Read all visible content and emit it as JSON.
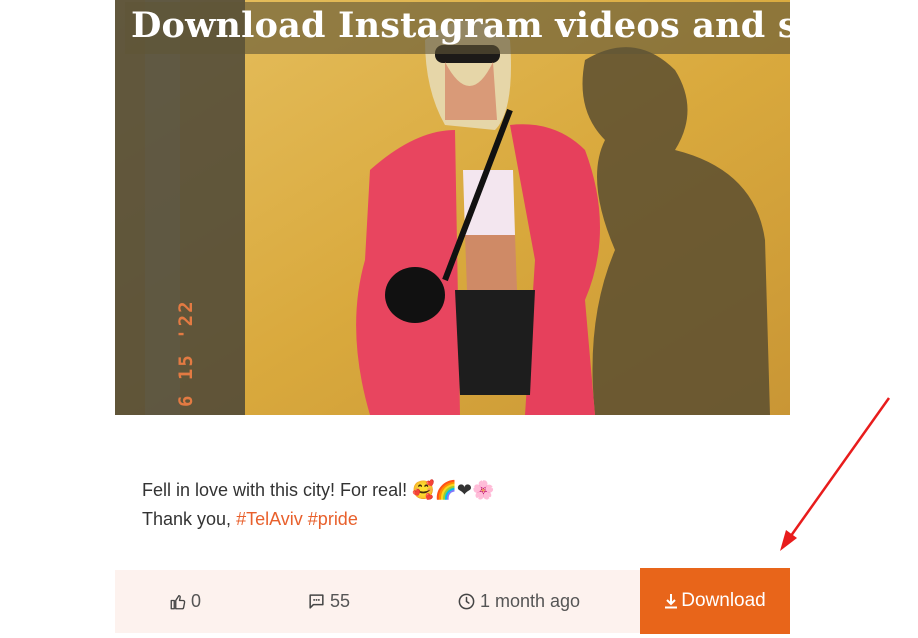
{
  "post": {
    "image_banner": "Download Instagram videos and stories",
    "image_stamp": "6 15 '22",
    "caption_line1": "Fell in love with this city! For real!",
    "caption_emojis": "🥰🌈❤🌸",
    "caption_line2_prefix": "Thank you,",
    "hashtags": [
      "#TelAviv",
      "#pride"
    ]
  },
  "stats": {
    "likes": "0",
    "comments": "55",
    "time": "1 month ago"
  },
  "download_button": {
    "label": "Download"
  },
  "icons": {
    "likes": "thumbs-up-icon",
    "comments": "comment-icon",
    "time": "clock-icon",
    "download": "download-icon"
  },
  "colors": {
    "accent": "#e8651a",
    "hashtag": "#e8602c",
    "footer_bg": "#fdf2ee",
    "arrow": "#e81c1c"
  }
}
